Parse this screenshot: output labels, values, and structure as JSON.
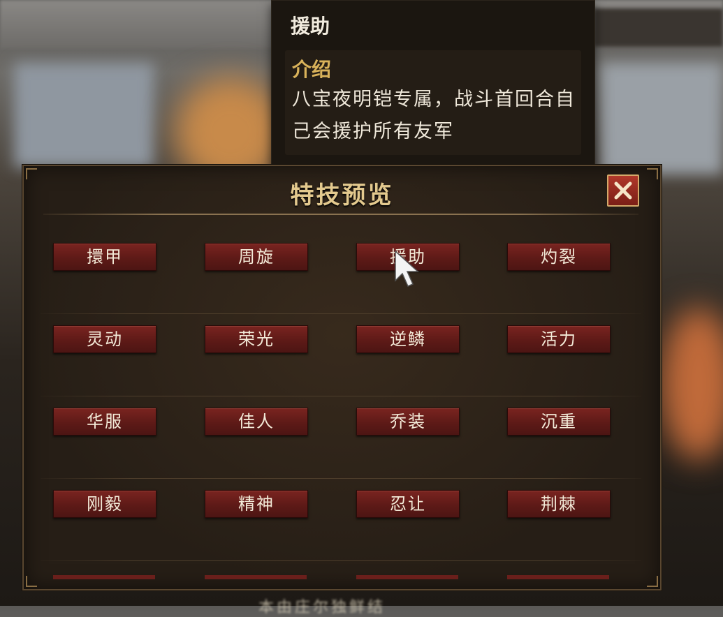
{
  "tooltip": {
    "title": "援助",
    "section_label": "介绍",
    "description": "八宝夜明铠专属，战斗首回合自己会援护所有友军"
  },
  "panel": {
    "title": "特技预览"
  },
  "skills": [
    [
      "擐甲",
      "周旋",
      "援助",
      "灼裂"
    ],
    [
      "灵动",
      "荣光",
      "逆鳞",
      "活力"
    ],
    [
      "华服",
      "佳人",
      "乔装",
      "沉重"
    ],
    [
      "刚毅",
      "精神",
      "忍让",
      "荆棘"
    ]
  ],
  "background": {
    "bottom_text": "本由庄尔独鲜结"
  },
  "colors": {
    "accent_gold": "#e3c98e",
    "skill_button": "#6b1e1b",
    "close_button": "#a0332a"
  },
  "icons": {
    "close": "close-icon",
    "cursor": "pointer-cursor-icon"
  }
}
